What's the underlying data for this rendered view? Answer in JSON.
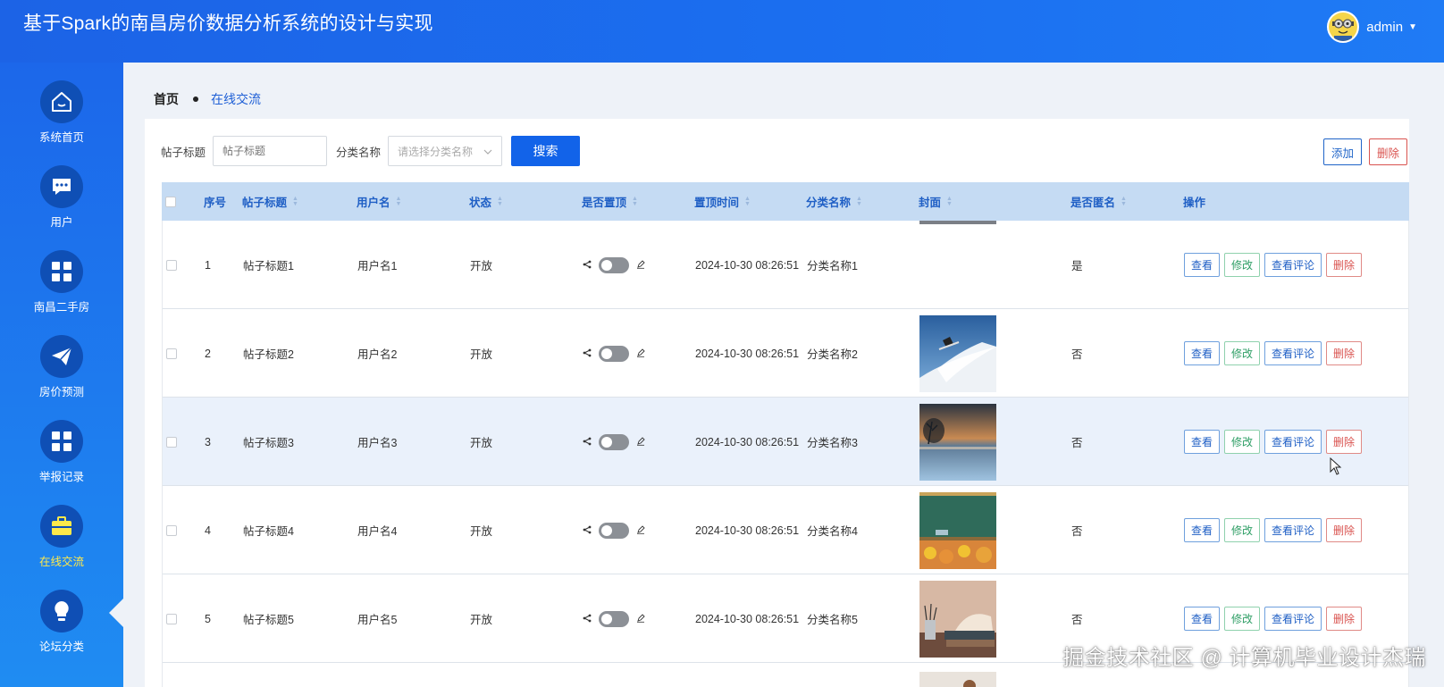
{
  "header": {
    "title": "基于Spark的南昌房价数据分析系统的设计与实现",
    "username": "admin"
  },
  "sidebar": {
    "items": [
      {
        "label": "系统首页",
        "icon": "home-icon"
      },
      {
        "label": "用户",
        "icon": "chat-icon"
      },
      {
        "label": "南昌二手房",
        "icon": "grid-icon"
      },
      {
        "label": "房价预测",
        "icon": "paper-plane-icon"
      },
      {
        "label": "举报记录",
        "icon": "grid-icon"
      },
      {
        "label": "在线交流",
        "icon": "briefcase-icon",
        "active": true
      },
      {
        "label": "论坛分类",
        "icon": "lightbulb-icon"
      }
    ]
  },
  "breadcrumb": {
    "home": "首页",
    "current": "在线交流"
  },
  "filters": {
    "title_label": "帖子标题",
    "title_placeholder": "帖子标题",
    "category_label": "分类名称",
    "category_placeholder": "请选择分类名称",
    "search_label": "搜索"
  },
  "toolbar": {
    "add_label": "添加",
    "delete_label": "删除"
  },
  "table": {
    "headers": {
      "index": "序号",
      "title": "帖子标题",
      "username": "用户名",
      "status": "状态",
      "pinned": "是否置顶",
      "pin_time": "置顶时间",
      "category": "分类名称",
      "cover": "封面",
      "anonymous": "是否匿名",
      "actions": "操作"
    },
    "rows": [
      {
        "index": "1",
        "title": "帖子标题1",
        "username": "用户名1",
        "status": "开放",
        "pin_time": "2024-10-30 08:26:51",
        "category": "分类名称1",
        "anonymous": "是"
      },
      {
        "index": "2",
        "title": "帖子标题2",
        "username": "用户名2",
        "status": "开放",
        "pin_time": "2024-10-30 08:26:51",
        "category": "分类名称2",
        "anonymous": "否"
      },
      {
        "index": "3",
        "title": "帖子标题3",
        "username": "用户名3",
        "status": "开放",
        "pin_time": "2024-10-30 08:26:51",
        "category": "分类名称3",
        "anonymous": "否"
      },
      {
        "index": "4",
        "title": "帖子标题4",
        "username": "用户名4",
        "status": "开放",
        "pin_time": "2024-10-30 08:26:51",
        "category": "分类名称4",
        "anonymous": "否"
      },
      {
        "index": "5",
        "title": "帖子标题5",
        "username": "用户名5",
        "status": "开放",
        "pin_time": "2024-10-30 08:26:51",
        "category": "分类名称5",
        "anonymous": "否"
      }
    ],
    "row_actions": {
      "view": "查看",
      "edit": "修改",
      "comments": "查看评论",
      "delete": "删除"
    }
  },
  "watermark": "掘金技术社区 @ 计算机毕业设计杰瑞",
  "colors": {
    "header": "#1c63e6",
    "primary": "#1263e9",
    "danger": "#d9534f",
    "success": "#2e9e65",
    "active_nav": "#ffe94a"
  }
}
